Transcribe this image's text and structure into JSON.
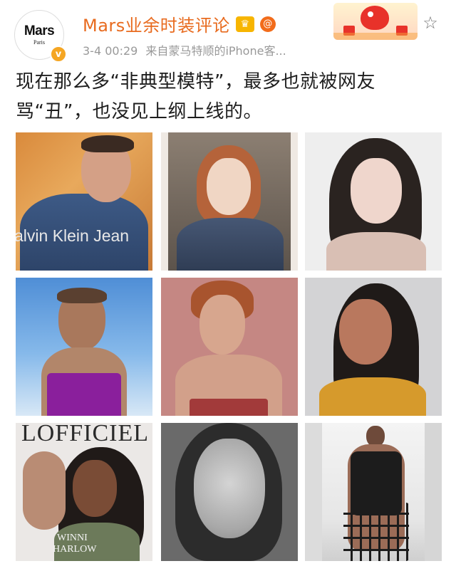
{
  "post": {
    "user_name": "Mars业余时装评论",
    "avatar": {
      "brand": "Mars",
      "sub": "Paris",
      "verified_glyph": "v"
    },
    "badges": [
      "crown-badge-icon",
      "swirl-badge-icon"
    ],
    "time": "3-4 00:29",
    "source_label": "来自",
    "source": "蒙马特顺的iPhone客...",
    "text": "现在那么多“非典型模特”，最多也就被网友骂“丑”，也没见上纲上线的。",
    "star_icon": "star-outline-icon"
  },
  "images": [
    {
      "name": "model-photo-1",
      "overlay": "alvin Klein Jean"
    },
    {
      "name": "model-photo-2"
    },
    {
      "name": "model-photo-3"
    },
    {
      "name": "model-photo-4"
    },
    {
      "name": "model-photo-5"
    },
    {
      "name": "model-photo-6"
    },
    {
      "name": "model-photo-7",
      "overlay": "LOFFICIEL",
      "caption_lines": [
        "WINNI",
        "HARLOW"
      ]
    },
    {
      "name": "model-photo-8"
    },
    {
      "name": "model-photo-9"
    }
  ],
  "colors": {
    "username": "#e86b1f",
    "meta": "#999999",
    "text": "#1e1e1e"
  }
}
